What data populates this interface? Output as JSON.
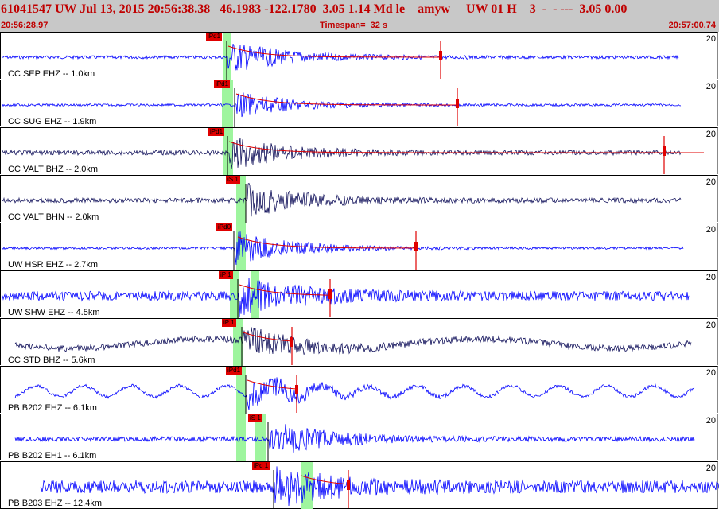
{
  "header": {
    "line1": "61041547 UW Jul 13, 2015 20:56:38.38   46.1983 -122.1780  3.05 1.14 Md le    amyw     UW 01 H    3  -  - ---  3.05 0.00",
    "start_time": "20:56:28.97",
    "timespan": "Timespan=  32 s",
    "end_time": "20:57:00.74"
  },
  "colors": {
    "header_bg": "#c8c8c8",
    "header_text": "#c00000",
    "pick": "#e00000",
    "window": "#9ef59e"
  },
  "traces": [
    {
      "label": "CC SEP EHZ -- 1.0km",
      "scale": "20",
      "pick": "iPd1",
      "color": "#0000ff"
    },
    {
      "label": "CC SUG EHZ -- 1.9km",
      "scale": "20",
      "pick": "iPd1",
      "color": "#0000ff"
    },
    {
      "label": "CC VALT BHZ -- 2.0km",
      "scale": "20",
      "pick": "iPd1",
      "color": "#10105a"
    },
    {
      "label": "CC VALT BHN -- 2.0km",
      "scale": "20",
      "pick": "iS 1",
      "color": "#10105a"
    },
    {
      "label": "UW HSR EHZ -- 2.7km",
      "scale": "20",
      "pick": "iPd0",
      "color": "#0000ff"
    },
    {
      "label": "UW SHW EHZ -- 4.5km",
      "scale": "20",
      "pick": "iP 1",
      "color": "#0000ff"
    },
    {
      "label": "CC STD BHZ -- 5.6km",
      "scale": "20",
      "pick": "iP 1",
      "color": "#10105a"
    },
    {
      "label": "PB B202 EHZ -- 6.1km",
      "scale": "20",
      "pick": "iPd1",
      "color": "#0000ff"
    },
    {
      "label": "PB B202 EH1 -- 6.1km",
      "scale": "20",
      "pick": "iS 1",
      "color": "#0000ff"
    },
    {
      "label": "PB B203 EHZ -- 12.4km",
      "scale": "20",
      "pick": "iPd 1",
      "color": "#0000ff"
    }
  ]
}
